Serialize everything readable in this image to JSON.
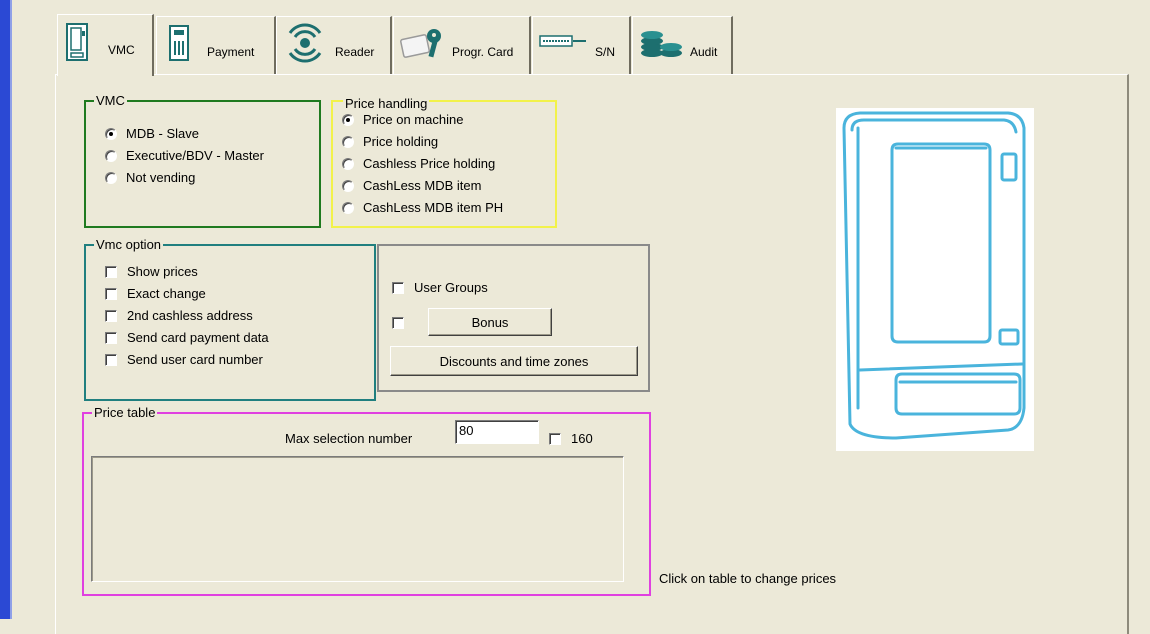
{
  "tabs": [
    {
      "label": "VMC",
      "active": true
    },
    {
      "label": "Payment",
      "active": false
    },
    {
      "label": "Reader",
      "active": false
    },
    {
      "label": "Progr. Card",
      "active": false
    },
    {
      "label": "S/N",
      "active": false
    },
    {
      "label": "Audit",
      "active": false
    }
  ],
  "vmc_group": {
    "title": "VMC",
    "options": [
      "MDB - Slave",
      "Executive/BDV - Master",
      "Not vending"
    ],
    "selected": "MDB - Slave",
    "border_color": "#1f7a1f"
  },
  "price_handling": {
    "title": "Price handling",
    "options": [
      "Price on machine",
      "Price holding",
      "Cashless Price holding",
      "CashLess MDB item",
      "CashLess MDB item PH"
    ],
    "selected": "Price on machine",
    "border_color": "#f2f24a"
  },
  "vmc_option": {
    "title": "Vmc option",
    "options": [
      "Show prices",
      "Exact change",
      "2nd cashless address",
      "Send card payment data",
      "Send user card number"
    ],
    "border_color": "#207f7f"
  },
  "extra_group": {
    "title": "",
    "user_groups_label": "User Groups",
    "bonus_label": "Bonus",
    "discounts_label": "Discounts and time zones",
    "border_color": "#8a8a8a"
  },
  "price_table": {
    "title": "Price table",
    "max_selection_label": "Max selection number",
    "max_selection_value": "80",
    "check_160_label": "160",
    "border_color": "#e040e0"
  },
  "hint_text": "Click on table to change prices",
  "icons": {
    "vmc": "vending-machine-icon",
    "payment": "coin-mech-icon",
    "reader": "wireless-reader-icon",
    "progr_card": "key-card-icon",
    "sn": "serial-number-icon",
    "audit": "audit-coins-icon"
  },
  "colors": {
    "window_bg": "#ece9d8",
    "left_accent": "#2b49d4",
    "machine_outline": "#4ab4dc"
  }
}
